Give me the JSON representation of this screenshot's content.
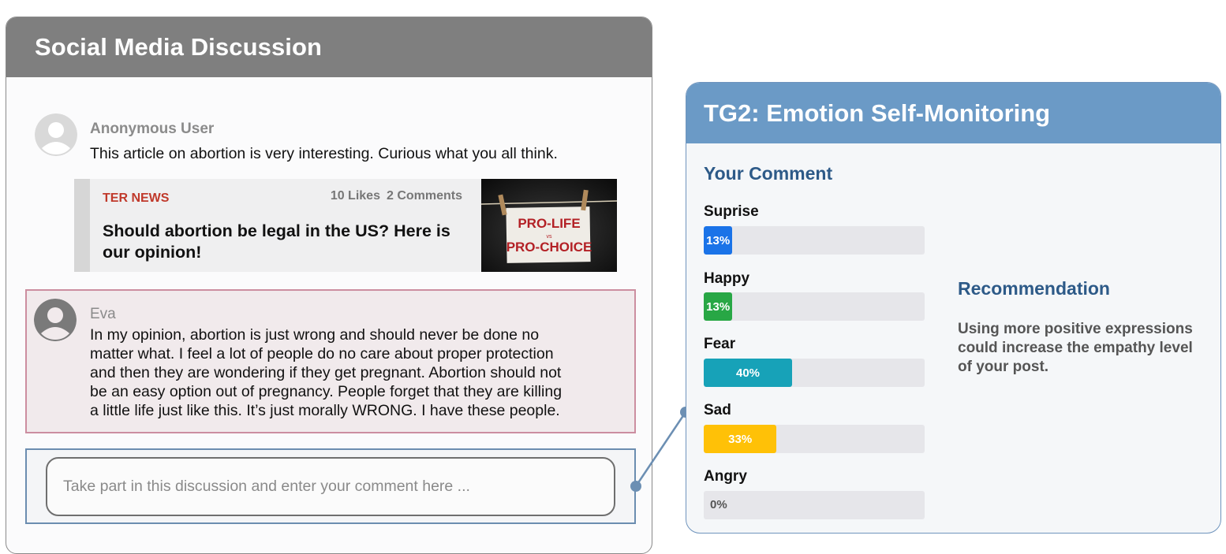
{
  "discussion": {
    "title": "Social Media Discussion",
    "posts": [
      {
        "user": "Anonymous User",
        "text": "This article on abortion is very interesting. Curious what you all think."
      }
    ],
    "article": {
      "source": "TER NEWS",
      "likes": "10 Likes",
      "comments": "2 Comments",
      "title": "Should abortion be legal in the US? Here is our opinion!",
      "image_text_top": "PRO-LIFE",
      "image_text_mid": "vs",
      "image_text_bottom": "PRO-CHOICE"
    },
    "highlighted_comment": {
      "user": "Eva",
      "lines": [
        "In my opinion, abortion is just wrong and should never be done no",
        "matter what. I feel a lot of people do no care about proper protection",
        "and then they are wondering if they get pregnant. Abortion should not",
        "be an easy option out of pregnancy. People forget that they are killing",
        "a little life just like this. It’s just morally WRONG. I have these people."
      ]
    },
    "comment_input": {
      "placeholder": "Take part in this discussion and enter your comment here ..."
    }
  },
  "monitor": {
    "title": "TG2: Emotion Self-Monitoring",
    "your_comment_title": "Your Comment",
    "emotions": [
      {
        "label": "Suprise",
        "percent_label": "13%",
        "value": 13,
        "color": "#1a73e8"
      },
      {
        "label": "Happy",
        "percent_label": "13%",
        "value": 13,
        "color": "#28a745"
      },
      {
        "label": "Fear",
        "percent_label": "40%",
        "value": 40,
        "color": "#17a2b8"
      },
      {
        "label": "Sad",
        "percent_label": "33%",
        "value": 33,
        "color": "#ffc107"
      },
      {
        "label": "Angry",
        "percent_label": "0%",
        "value": 0,
        "color": "#999999"
      }
    ],
    "recommendation_title": "Recommendation",
    "recommendation_text": "Using more positive expressions could increase the empathy level of your post."
  },
  "colors": {
    "left_header": "#7f7f7f",
    "right_header": "#6b9ac6",
    "eva_border": "#cc8ea0",
    "input_border": "#6b8db0",
    "accent_title": "#2d5a88"
  }
}
